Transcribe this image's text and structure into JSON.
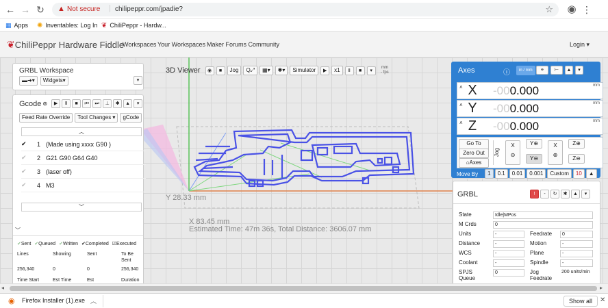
{
  "browser": {
    "security_label": "Not secure",
    "url": "chilipeppr.com/jpadie?",
    "bookmarks": [
      "Apps",
      "Inventables: Log In",
      "ChiliPeppr - Hardw..."
    ]
  },
  "header": {
    "brand": "ChiliPeppr",
    "brand_suffix": "Hardware Fiddle",
    "nav": [
      "Workspaces",
      "Your Workspaces",
      "Maker Forums Community"
    ],
    "login": "Login"
  },
  "workspace_widget": {
    "title": "GRBL Workspace",
    "widgets_label": "Widgets"
  },
  "gcode_widget": {
    "title": "Gcode",
    "feed_rate_button": "Feed Rate Override",
    "tool_changes_button": "Tool Changes",
    "gcode_button": "gCode",
    "lines": [
      {
        "num": "1",
        "text": "(Made using xxxx G90 )"
      },
      {
        "num": "2",
        "text": "G21 G90 G64 G40"
      },
      {
        "num": "3",
        "text": "(laser off)"
      },
      {
        "num": "4",
        "text": "M3"
      }
    ],
    "legend": [
      "Sent",
      "Queued",
      "Written",
      "Completed",
      "Executed"
    ],
    "stats_headers": [
      "Lines",
      "Showing",
      "Sent",
      "To Be Sent"
    ],
    "stats_values": [
      "256,340",
      "0",
      "0",
      "256,340"
    ],
    "stats_headers2": [
      "Time Start",
      "Est Time",
      "Est",
      "Duration"
    ]
  },
  "viewer": {
    "title": "3D Viewer",
    "jog_label": "Jog",
    "simulator_label": "Simulator",
    "speed_label": "x1",
    "fps_top": "mm",
    "fps_bottom": "- fps",
    "y_readout": "Y 28.33 mm",
    "x_readout": "X 83.45 mm",
    "estimate": "Estimated Time: 47m 36s, Total Distance: 3606.07 mm"
  },
  "axes_widget": {
    "title": "Axes",
    "unit_toggle": "in / mm",
    "axes": [
      {
        "label": "X",
        "ghost": "-00",
        "value": "0.000",
        "unit": "mm"
      },
      {
        "label": "Y",
        "ghost": "-00",
        "value": "0.000",
        "unit": "mm"
      },
      {
        "label": "Z",
        "ghost": "-00",
        "value": "0.000",
        "unit": "mm"
      }
    ],
    "go_to_zero": "Go To Zero",
    "zero_out": "Zero Out",
    "axes_button": "Axes",
    "jog_label": "Jog",
    "jog_x": "X",
    "jog_y": "Y",
    "jog_z": "Z",
    "move_by_label": "Move By",
    "move_by_options": [
      "1",
      "0.1",
      "0.01",
      "0.001"
    ],
    "custom_label": "Custom",
    "custom_value": "10"
  },
  "grbl_widget": {
    "title": "GRBL",
    "fields": [
      {
        "label": "State",
        "value": "Idle|MPos"
      },
      {
        "label": "M Crds",
        "value": "0"
      },
      {
        "label": "Units",
        "value": "-",
        "label2": "Feedrate",
        "value2": "0"
      },
      {
        "label": "Distance",
        "value": "-",
        "label2": "Motion",
        "value2": "-"
      },
      {
        "label": "WCS",
        "value": "-",
        "label2": "Plane",
        "value2": "-"
      },
      {
        "label": "Coolant",
        "value": "-",
        "label2": "Spindle",
        "value2": "-"
      },
      {
        "label": "SPJS Queue",
        "value": "0",
        "label2": "Jog Feedrate",
        "value2": "200 units/min"
      }
    ]
  },
  "downloads": {
    "file": "Firefox Installer (1).exe",
    "show_all": "Show all"
  },
  "colors": {
    "axes_blue": "#2f80d2",
    "toolpath": "#4a52e6",
    "brand_red": "#c8202b"
  }
}
